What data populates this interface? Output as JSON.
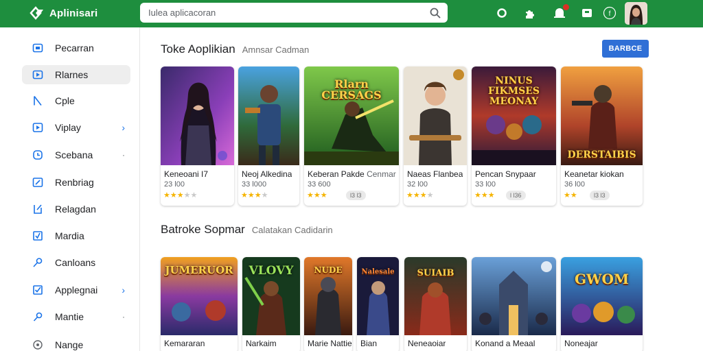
{
  "header": {
    "app_title": "Aplinisari",
    "search_placeholder": "Iulea aplicacoran",
    "accent_color": "#1e8e3e",
    "icons": [
      "search-icon",
      "circle-icon",
      "puzzle-icon",
      "notifications-icon",
      "apps-icon",
      "help-icon",
      "avatar"
    ]
  },
  "sidebar": {
    "items": [
      {
        "label": "Pecarran",
        "icon": "home-icon"
      },
      {
        "label": "Rlarnes",
        "icon": "games-icon",
        "active": true
      },
      {
        "label": "Cple",
        "icon": "bookmark-icon"
      },
      {
        "label": "Viplay",
        "icon": "play-icon",
        "chevron": "›"
      },
      {
        "label": "Scebana",
        "icon": "clock-icon",
        "dot": "·"
      },
      {
        "label": "Renbriag",
        "icon": "edit-icon"
      },
      {
        "label": "Relagdan",
        "icon": "share-icon"
      },
      {
        "label": "Mardia",
        "icon": "check-icon"
      },
      {
        "label": "Canloans",
        "icon": "key-icon"
      },
      {
        "label": "Applegnai",
        "icon": "checkbox-icon",
        "chevron": "›"
      },
      {
        "label": "Mantie",
        "icon": "pen-icon",
        "dot": "·"
      },
      {
        "label": "Nange",
        "icon": "location-icon"
      }
    ]
  },
  "sections": [
    {
      "title": "Toke Aoplikian",
      "subtitle": "Amnsar Cadman",
      "button": "BARBCE",
      "cards": [
        {
          "title": "Keneoani I7",
          "sub": "23 l00",
          "stars": 3,
          "pill": ""
        },
        {
          "title": "Neoj Alkedina",
          "sub": "33 l000",
          "stars": 3,
          "pill": ""
        },
        {
          "title": "Keberan Pakde",
          "title_extra": "Cenmar",
          "sub": "33 600",
          "stars": 3,
          "pill": "l3 l3",
          "art_text": "Rlarn CERSAGS"
        },
        {
          "title": "Naeas Flanbea",
          "sub": "32 l00",
          "stars": 3,
          "pill": ""
        },
        {
          "title": "Pencan Snypaar",
          "sub": "33 l00",
          "stars": 3,
          "pill": "l l36",
          "art_text": "NINUS FIKMSES MEONAY"
        },
        {
          "title": "Keanetar kiokan",
          "sub": "36 l00",
          "stars": 2,
          "pill": "l3 l3",
          "art_text": "DERSTAIBIS"
        }
      ]
    },
    {
      "title": "Batroke Sopmar",
      "subtitle": "Calatakan Cadidarin",
      "cards": [
        {
          "title": "Kemararan",
          "art_text": "JUMERUOR"
        },
        {
          "title": "Narkaim",
          "art_text": "VLOVY"
        },
        {
          "title": "Marie Nattie",
          "art_text": "NUDE"
        },
        {
          "title": "Bian",
          "art_text": "Nalesale"
        },
        {
          "title": "Neneaoiar",
          "art_text": "SUIAIB"
        },
        {
          "title": "Konand a Meaal",
          "art_text": ""
        },
        {
          "title": "Noneajar",
          "art_text": "GWOM"
        }
      ]
    }
  ]
}
